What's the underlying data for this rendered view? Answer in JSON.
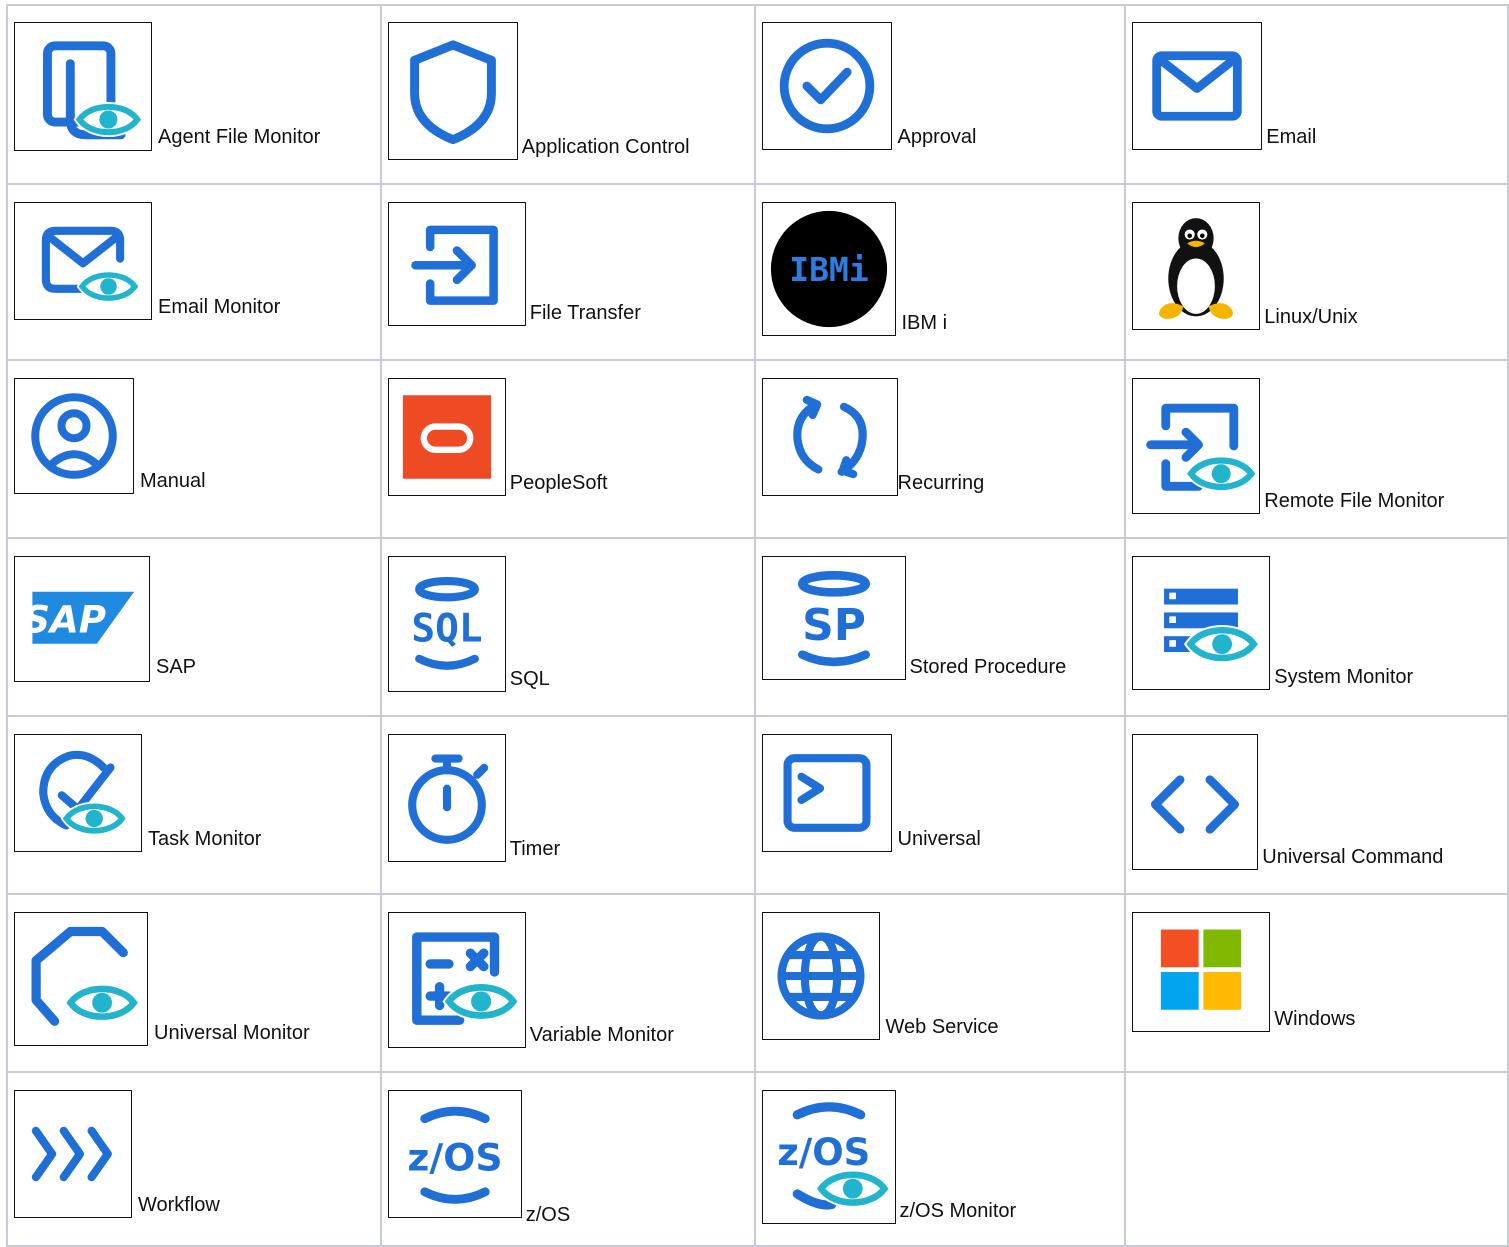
{
  "colors": {
    "primary_blue": "#1f6fd6",
    "eye_teal": "#21b4cc",
    "grid_border": "#c8cad6",
    "peoplesoft_red": "#ee4b25",
    "windows_red": "#f25022",
    "windows_green": "#7fba00",
    "windows_blue": "#00a4ef",
    "windows_yellow": "#ffb900"
  },
  "items": [
    {
      "label": "Agent File Monitor",
      "icon": "agent-file-monitor-icon"
    },
    {
      "label": "Application Control",
      "icon": "application-control-icon"
    },
    {
      "label": "Approval",
      "icon": "approval-icon"
    },
    {
      "label": "Email",
      "icon": "email-icon"
    },
    {
      "label": "Email Monitor",
      "icon": "email-monitor-icon"
    },
    {
      "label": "File Transfer",
      "icon": "file-transfer-icon"
    },
    {
      "label": "IBM i",
      "icon": "ibm-i-icon",
      "icon_text": "IBMi"
    },
    {
      "label": "Linux/Unix",
      "icon": "linux-unix-icon"
    },
    {
      "label": "Manual",
      "icon": "manual-icon"
    },
    {
      "label": "PeopleSoft",
      "icon": "peoplesoft-icon"
    },
    {
      "label": "Recurring",
      "icon": "recurring-icon"
    },
    {
      "label": "Remote File Monitor",
      "icon": "remote-file-monitor-icon"
    },
    {
      "label": "SAP",
      "icon": "sap-icon",
      "icon_text": "SAP"
    },
    {
      "label": "SQL",
      "icon": "sql-icon",
      "icon_text": "SQL"
    },
    {
      "label": "Stored Procedure",
      "icon": "stored-procedure-icon",
      "icon_text": "SP"
    },
    {
      "label": "System Monitor",
      "icon": "system-monitor-icon"
    },
    {
      "label": "Task Monitor",
      "icon": "task-monitor-icon"
    },
    {
      "label": "Timer",
      "icon": "timer-icon"
    },
    {
      "label": "Universal",
      "icon": "universal-icon"
    },
    {
      "label": "Universal Command",
      "icon": "universal-command-icon"
    },
    {
      "label": "Universal Monitor",
      "icon": "universal-monitor-icon"
    },
    {
      "label": "Variable Monitor",
      "icon": "variable-monitor-icon"
    },
    {
      "label": "Web Service",
      "icon": "web-service-icon"
    },
    {
      "label": "Windows",
      "icon": "windows-icon"
    },
    {
      "label": "Workflow",
      "icon": "workflow-icon"
    },
    {
      "label": "z/OS",
      "icon": "zos-icon",
      "icon_text": "z/OS"
    },
    {
      "label": "z/OS Monitor",
      "icon": "zos-monitor-icon",
      "icon_text": "z/OS"
    }
  ]
}
